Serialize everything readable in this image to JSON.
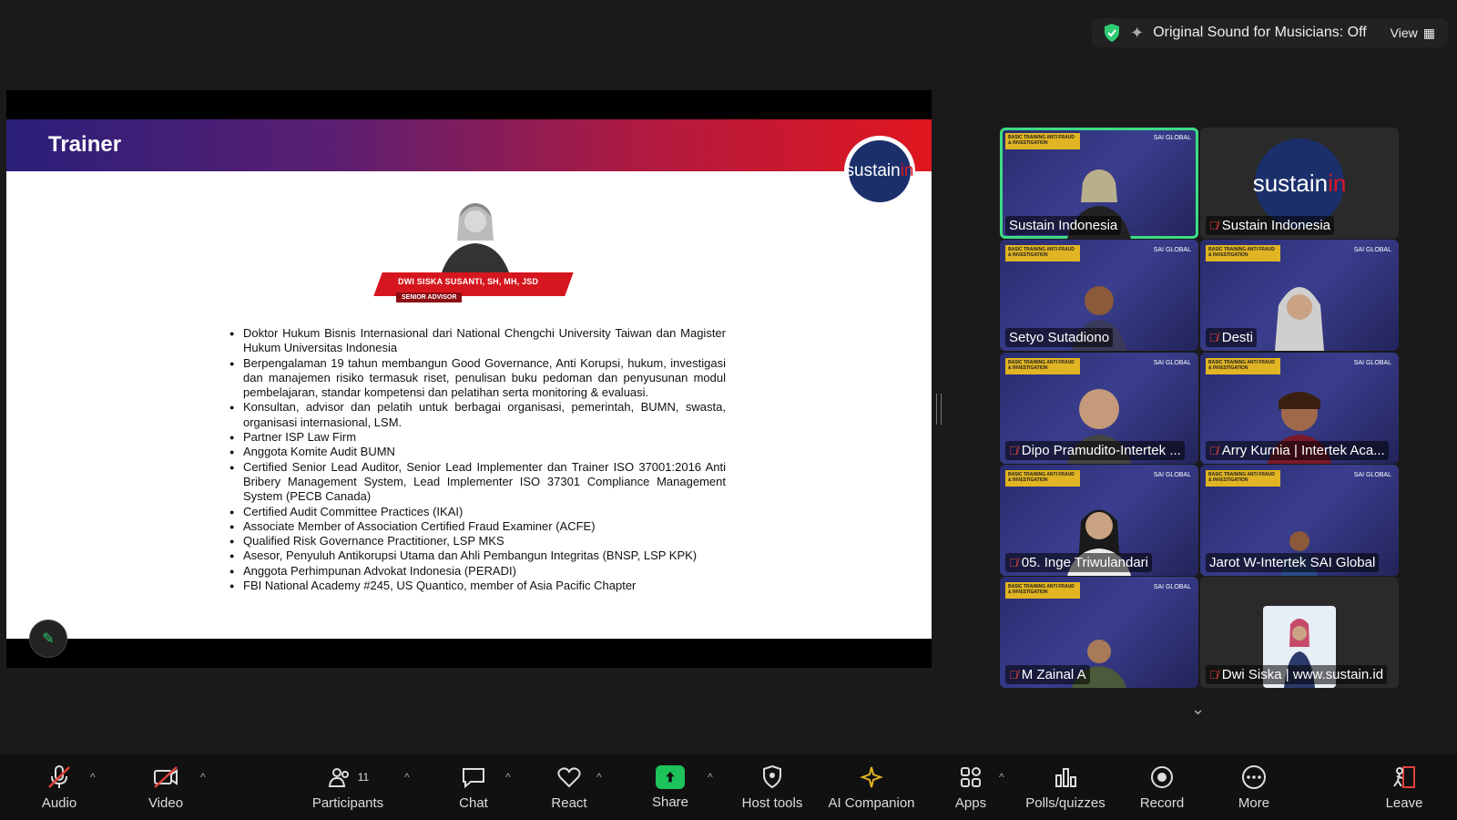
{
  "status": {
    "sound_label": "Original Sound for Musicians: Off",
    "view_label": "View"
  },
  "slide": {
    "title": "Trainer",
    "brand": "sustain",
    "brand_accent": "in",
    "trainer_name": "DWI SISKA SUSANTI, SH, MH, JSD",
    "trainer_role": "SENIOR ADVISOR",
    "bullets": [
      "Doktor Hukum Bisnis Internasional dari National Chengchi University Taiwan dan Magister Hukum Universitas Indonesia",
      "Berpengalaman 19 tahun membangun Good Governance, Anti Korupsi, hukum, investigasi dan manajemen risiko termasuk riset, penulisan buku pedoman dan penyusunan modul pembelajaran, standar kompetensi dan pelatihan serta monitoring & evaluasi.",
      "Konsultan, advisor dan pelatih untuk berbagai organisasi, pemerintah, BUMN, swasta, organisasi internasional, LSM.",
      "Partner ISP Law Firm",
      "Anggota Komite Audit BUMN",
      "Certified Senior Lead Auditor, Senior Lead Implementer dan Trainer ISO 37001:2016 Anti Bribery Management System, Lead Implementer ISO 37301 Compliance Management System (PECB Canada)",
      "Certified Audit Committee Practices (IKAI)",
      "Associate Member of Association Certified Fraud Examiner (ACFE)",
      "Qualified Risk Governance Practitioner, LSP MKS",
      "Asesor, Penyuluh Antikorupsi Utama dan Ahli Pembangun Integritas (BNSP, LSP KPK)",
      "Anggota Perhimpunan Advokat Indonesia (PERADI)",
      "FBI National Academy #245, US Quantico, member of Asia Pacific Chapter"
    ]
  },
  "tile_banner": "BASIC TRAINING ANTI FRAUD & INVESTIGATION",
  "tile_logo": "SAI GLOBAL",
  "participants": [
    {
      "name": "Sustain Indonesia",
      "muted": false,
      "active": true,
      "logo": false
    },
    {
      "name": "Sustain Indonesia",
      "muted": true,
      "active": false,
      "logo": true
    },
    {
      "name": "Setyo Sutadiono",
      "muted": false,
      "active": false,
      "logo": false
    },
    {
      "name": "Desti",
      "muted": true,
      "active": false,
      "logo": false
    },
    {
      "name": "Dipo Pramudito-Intertek ...",
      "muted": true,
      "active": false,
      "logo": false
    },
    {
      "name": "Arry Kurnia | Intertek Aca...",
      "muted": true,
      "active": false,
      "logo": false
    },
    {
      "name": "05. Inge Triwulandari",
      "muted": true,
      "active": false,
      "logo": false
    },
    {
      "name": "Jarot  W-Intertek SAI Global",
      "muted": false,
      "active": false,
      "logo": false
    },
    {
      "name": "M Zainal A",
      "muted": true,
      "active": false,
      "logo": false
    },
    {
      "name": "Dwi Siska | www.sustain.id",
      "muted": true,
      "active": false,
      "logo": false
    }
  ],
  "toolbar": {
    "audio": "Audio",
    "video": "Video",
    "participants": "Participants",
    "participants_count": "11",
    "chat": "Chat",
    "react": "React",
    "share": "Share",
    "host_tools": "Host tools",
    "ai_companion": "AI Companion",
    "apps": "Apps",
    "polls": "Polls/quizzes",
    "record": "Record",
    "more": "More",
    "leave": "Leave"
  }
}
